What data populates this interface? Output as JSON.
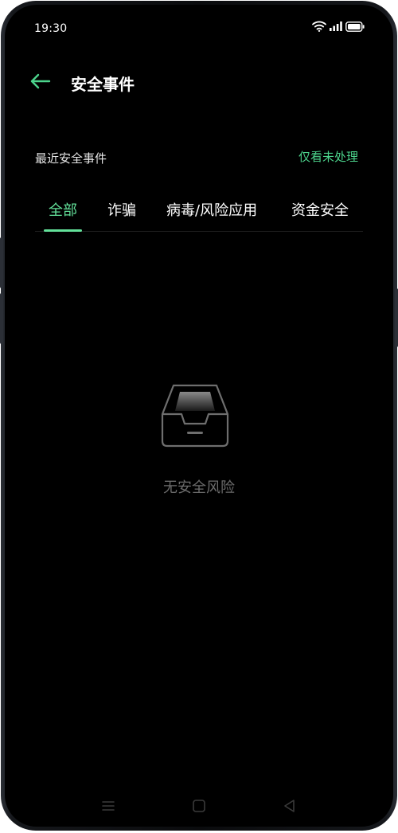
{
  "status_bar": {
    "time": "19:30",
    "icons": [
      "wifi-icon",
      "signal-icon",
      "battery-icon"
    ]
  },
  "appbar": {
    "back_icon": "arrow-left-icon",
    "title": "安全事件"
  },
  "section": {
    "title": "最近安全事件",
    "filter_label": "仅看未处理"
  },
  "tabs": [
    {
      "label": "全部",
      "active": true
    },
    {
      "label": "诈骗",
      "active": false
    },
    {
      "label": "病毒/风险应用",
      "active": false
    },
    {
      "label": "资金安全",
      "active": false
    }
  ],
  "empty_state": {
    "icon": "inbox-tray-icon",
    "message": "无安全风险"
  },
  "nav_bar": {
    "icons": [
      "menu-icon",
      "home-square-icon",
      "back-triangle-icon"
    ]
  },
  "colors": {
    "accent": "#4cd48c",
    "tab_active": "#63e19a",
    "background": "#000000",
    "muted_text": "#6b6b6b"
  }
}
